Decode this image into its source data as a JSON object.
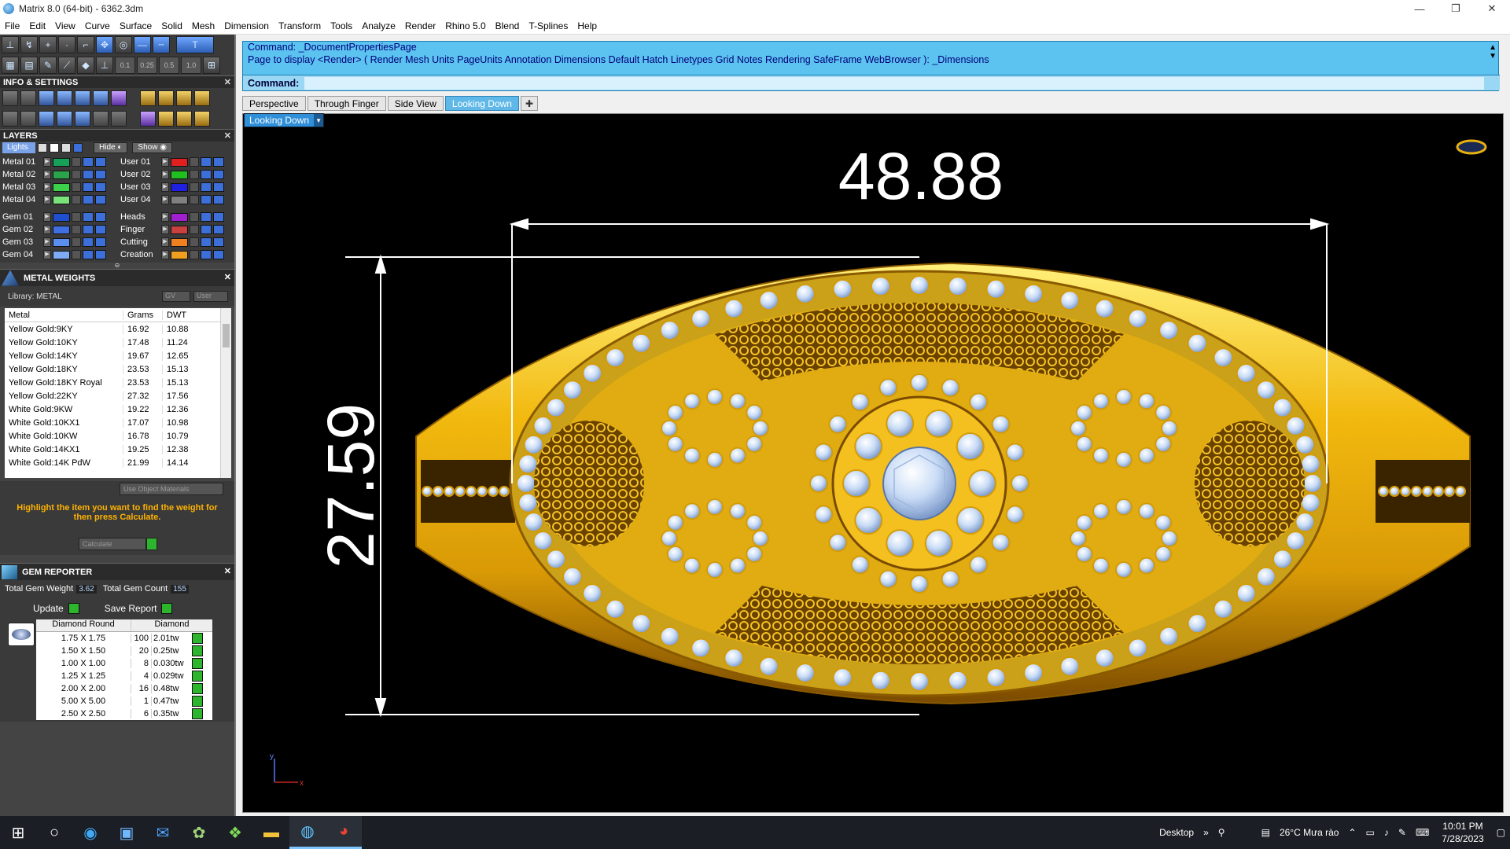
{
  "window": {
    "title": "Matrix 8.0 (64-bit) - 6362.3dm",
    "min": "—",
    "restore": "❐",
    "close": "✕"
  },
  "menu": [
    "File",
    "Edit",
    "View",
    "Curve",
    "Surface",
    "Solid",
    "Mesh",
    "Dimension",
    "Transform",
    "Tools",
    "Analyze",
    "Render",
    "Rhino 5.0",
    "Blend",
    "T-Splines",
    "Help"
  ],
  "snap_values": [
    "0.1",
    "0.25",
    "0.5",
    "1.0"
  ],
  "info_settings": {
    "title": "INFO & SETTINGS"
  },
  "layers": {
    "title": "LAYERS",
    "lights": "Lights",
    "hide": "Hide",
    "show": "Show",
    "left": [
      {
        "name": "Metal 01",
        "color": "#17a05a"
      },
      {
        "name": "Metal 02",
        "color": "#2aa34a"
      },
      {
        "name": "Metal 03",
        "color": "#3ccf4a"
      },
      {
        "name": "Metal 04",
        "color": "#7ae27a"
      },
      {
        "name": "Gem 01",
        "color": "#1f4fcf"
      },
      {
        "name": "Gem 02",
        "color": "#3f6fe0"
      },
      {
        "name": "Gem 03",
        "color": "#5a8ff0"
      },
      {
        "name": "Gem 04",
        "color": "#7faaf5"
      }
    ],
    "right": [
      {
        "name": "User 01",
        "color": "#e02020"
      },
      {
        "name": "User 02",
        "color": "#20c020"
      },
      {
        "name": "User 03",
        "color": "#2020e0"
      },
      {
        "name": "User 04",
        "color": "#808080"
      },
      {
        "name": "Heads",
        "color": "#a020d0"
      },
      {
        "name": "Finger",
        "color": "#c84040"
      },
      {
        "name": "Cutting",
        "color": "#f08020"
      },
      {
        "name": "Creation",
        "color": "#f0a020"
      }
    ]
  },
  "metal_weights": {
    "title": "METAL WEIGHTS",
    "library": "Library: METAL",
    "gv": "GV",
    "user": "User",
    "columns": [
      "Metal",
      "Grams",
      "DWT"
    ],
    "rows": [
      [
        "Yellow Gold:9KY",
        "16.92",
        "10.88"
      ],
      [
        "Yellow Gold:10KY",
        "17.48",
        "11.24"
      ],
      [
        "Yellow Gold:14KY",
        "19.67",
        "12.65"
      ],
      [
        "Yellow Gold:18KY",
        "23.53",
        "15.13"
      ],
      [
        "Yellow Gold:18KY Royal",
        "23.53",
        "15.13"
      ],
      [
        "Yellow Gold:22KY",
        "27.32",
        "17.56"
      ],
      [
        "White Gold:9KW",
        "19.22",
        "12.36"
      ],
      [
        "White Gold:10KX1",
        "17.07",
        "10.98"
      ],
      [
        "White Gold:10KW",
        "16.78",
        "10.79"
      ],
      [
        "White Gold:14KX1",
        "19.25",
        "12.38"
      ],
      [
        "White Gold:14K PdW",
        "21.99",
        "14.14"
      ]
    ],
    "use_object_materials": "Use Object Materials",
    "hint": "Highlight the item you want to find the weight for then press Calculate.",
    "calculate": "Calculate"
  },
  "gem_reporter": {
    "title": "GEM REPORTER",
    "total_weight_label": "Total Gem Weight",
    "total_weight": "3.62",
    "total_count_label": "Total Gem Count",
    "total_count": "155",
    "update": "Update",
    "save_report": "Save Report",
    "columns": [
      "Diamond Round",
      "Diamond"
    ],
    "rows": [
      [
        "1.75 X 1.75",
        "100",
        "2.01tw"
      ],
      [
        "1.50 X 1.50",
        "20",
        "0.25tw"
      ],
      [
        "1.00 X 1.00",
        "8",
        "0.030tw"
      ],
      [
        "1.25 X 1.25",
        "4",
        "0.029tw"
      ],
      [
        "2.00 X 2.00",
        "16",
        "0.48tw"
      ],
      [
        "5.00 X 5.00",
        "1",
        "0.47tw"
      ],
      [
        "2.50 X 2.50",
        "6",
        "0.35tw"
      ]
    ]
  },
  "command": {
    "line1": "Command: _DocumentPropertiesPage",
    "line2": "Page to display <Render> ( Render  Mesh  Units  PageUnits  Annotation  Dimensions  Default  Hatch  Linetypes  Grid  Notes  Rendering  SafeFrame  WebBrowser ): _Dimensions",
    "prompt": "Command:"
  },
  "viewport_tabs": [
    "Perspective",
    "Through Finger",
    "Side View",
    "Looking Down"
  ],
  "active_tab": "Looking Down",
  "viewport": {
    "label": "Looking Down",
    "dim_width": "48.88",
    "dim_height": "27.59",
    "axis_y": "y",
    "axis_x": "x"
  },
  "taskbar": {
    "desktop": "Desktop",
    "weather": "26°C  Mưa rào",
    "time": "10:01 PM",
    "date": "7/28/2023"
  },
  "colors": {
    "gold": "#e8b10e",
    "gem": "#bcd4f2",
    "cmd_bg": "#5cc2f0",
    "accent": "#2f8fd8"
  }
}
